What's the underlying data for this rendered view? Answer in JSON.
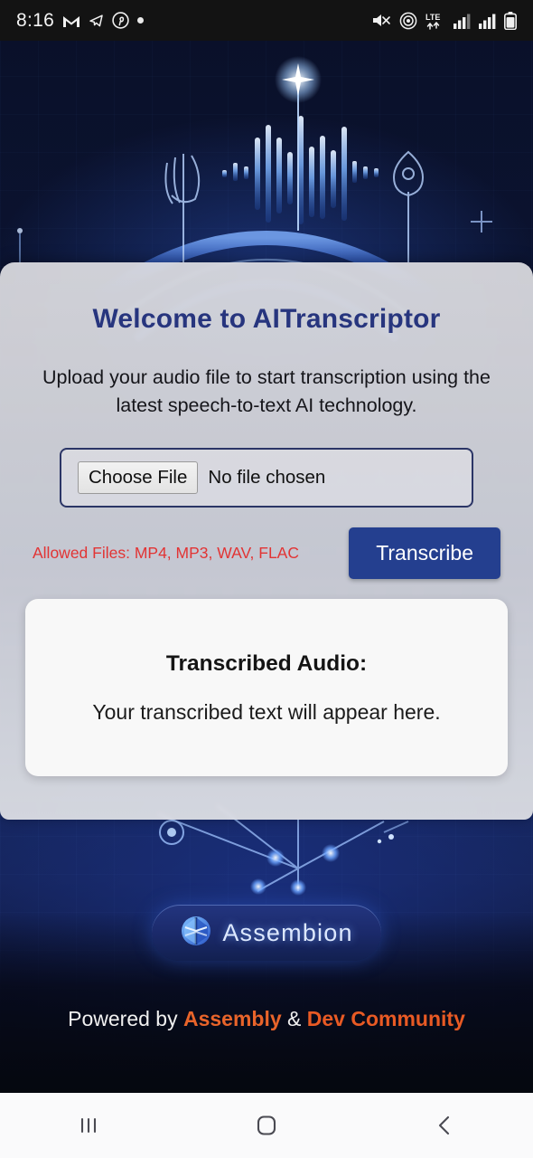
{
  "status_bar": {
    "time": "8:16",
    "left_icons": [
      "gmail-icon",
      "telegram-icon",
      "pinterest-icon",
      "dot-indicator-icon"
    ],
    "right_icons": [
      "mute-vibrate-icon",
      "hotspot-icon",
      "lte-data-icon",
      "signal-bars-sim1-icon",
      "signal-bars-sim2-icon",
      "battery-icon"
    ],
    "network_label": "LTE"
  },
  "app": {
    "title": "Welcome to AITranscriptor",
    "subtitle": "Upload your audio file to start transcription using the latest speech-to-text AI technology.",
    "file_input": {
      "button_label": "Choose File",
      "status_text": "No file chosen"
    },
    "allowed_files": "Allowed Files: MP4, MP3, WAV, FLAC",
    "transcribe_button": "Transcribe",
    "result": {
      "heading": "Transcribed Audio:",
      "placeholder": "Your transcribed text will appear here."
    }
  },
  "brand": {
    "name": "Assembion",
    "logo_icon": "assembion-hexagon-logo-icon"
  },
  "footer": {
    "prefix": "Powered by ",
    "partner_one": "Assembly",
    "separator": " & ",
    "partner_two": "Dev Community"
  },
  "nav_bar": {
    "recents_icon": "recents-icon",
    "home_icon": "home-icon",
    "back_icon": "back-icon"
  },
  "colors": {
    "title_navy": "#27357e",
    "button_navy": "#243f8f",
    "allowed_red": "#e23434",
    "footer_orange": "#e8642a",
    "panel_gray": "#dedee2",
    "background_navy": "#132257"
  }
}
